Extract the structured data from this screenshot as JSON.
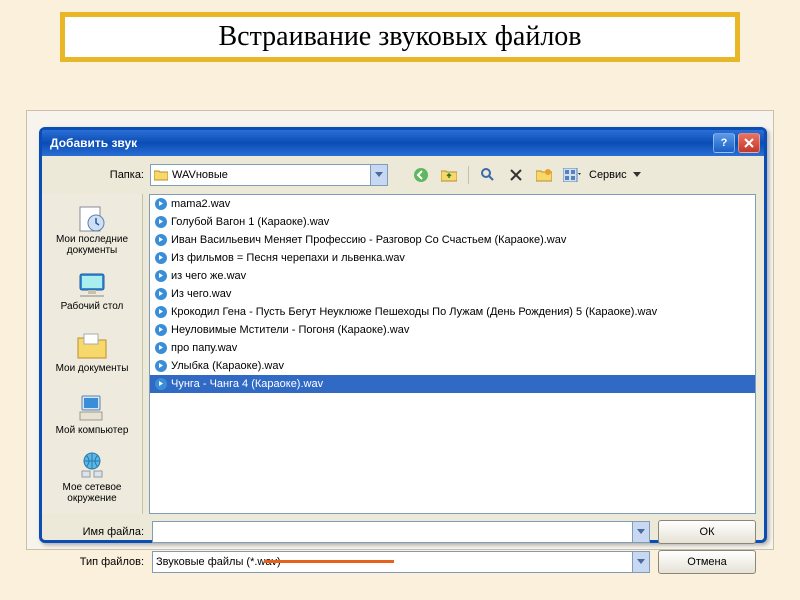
{
  "slide": {
    "title": "Встраивание звуковых файлов"
  },
  "dialog": {
    "title": "Добавить звук",
    "folder_label": "Папка:",
    "folder_value": "WAVновые",
    "tools_label": "Сервис",
    "places": [
      {
        "id": "recent",
        "label": "Мои последние документы"
      },
      {
        "id": "desktop",
        "label": "Рабочий стол"
      },
      {
        "id": "mydocs",
        "label": "Мои документы"
      },
      {
        "id": "mycomputer",
        "label": "Мой компьютер"
      },
      {
        "id": "network",
        "label": "Мое сетевое окружение"
      }
    ],
    "files": [
      {
        "name": "mama2.wav",
        "selected": false
      },
      {
        "name": "Голубой Вагон 1 (Караоке).wav",
        "selected": false
      },
      {
        "name": "Иван Васильевич Меняет Профессию - Разговор Со Счастьем (Караоке).wav",
        "selected": false
      },
      {
        "name": "Из фильмов = Песня черепахи и львенка.wav",
        "selected": false
      },
      {
        "name": "из чего же.wav",
        "selected": false
      },
      {
        "name": "Из чего.wav",
        "selected": false
      },
      {
        "name": "Крокодил Гена - Пусть Бегут Неуклюже Пешеходы По Лужам (День Рождения) 5 (Караоке).wav",
        "selected": false
      },
      {
        "name": "Неуловимые Мстители - Погоня (Караоке).wav",
        "selected": false
      },
      {
        "name": "про папу.wav",
        "selected": false
      },
      {
        "name": "Улыбка (Караоке).wav",
        "selected": false
      },
      {
        "name": "Чунга - Чанга 4 (Караоке).wav",
        "selected": true
      }
    ],
    "filename_label": "Имя файла:",
    "filename_value": "",
    "filetype_label": "Тип файлов:",
    "filetype_value": "Звуковые файлы (*.wav)",
    "ok_label": "ОК",
    "cancel_label": "Отмена"
  }
}
